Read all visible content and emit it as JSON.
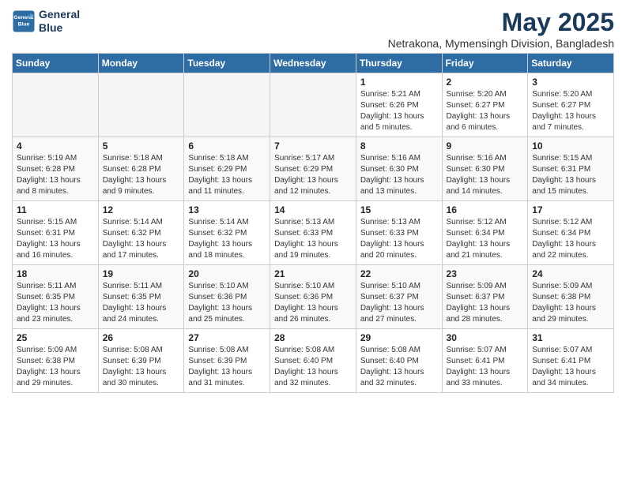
{
  "logo": {
    "line1": "General",
    "line2": "Blue"
  },
  "title": "May 2025",
  "subtitle": "Netrakona, Mymensingh Division, Bangladesh",
  "days_of_week": [
    "Sunday",
    "Monday",
    "Tuesday",
    "Wednesday",
    "Thursday",
    "Friday",
    "Saturday"
  ],
  "weeks": [
    [
      {
        "day": "",
        "info": ""
      },
      {
        "day": "",
        "info": ""
      },
      {
        "day": "",
        "info": ""
      },
      {
        "day": "",
        "info": ""
      },
      {
        "day": "1",
        "info": "Sunrise: 5:21 AM\nSunset: 6:26 PM\nDaylight: 13 hours\nand 5 minutes."
      },
      {
        "day": "2",
        "info": "Sunrise: 5:20 AM\nSunset: 6:27 PM\nDaylight: 13 hours\nand 6 minutes."
      },
      {
        "day": "3",
        "info": "Sunrise: 5:20 AM\nSunset: 6:27 PM\nDaylight: 13 hours\nand 7 minutes."
      }
    ],
    [
      {
        "day": "4",
        "info": "Sunrise: 5:19 AM\nSunset: 6:28 PM\nDaylight: 13 hours\nand 8 minutes."
      },
      {
        "day": "5",
        "info": "Sunrise: 5:18 AM\nSunset: 6:28 PM\nDaylight: 13 hours\nand 9 minutes."
      },
      {
        "day": "6",
        "info": "Sunrise: 5:18 AM\nSunset: 6:29 PM\nDaylight: 13 hours\nand 11 minutes."
      },
      {
        "day": "7",
        "info": "Sunrise: 5:17 AM\nSunset: 6:29 PM\nDaylight: 13 hours\nand 12 minutes."
      },
      {
        "day": "8",
        "info": "Sunrise: 5:16 AM\nSunset: 6:30 PM\nDaylight: 13 hours\nand 13 minutes."
      },
      {
        "day": "9",
        "info": "Sunrise: 5:16 AM\nSunset: 6:30 PM\nDaylight: 13 hours\nand 14 minutes."
      },
      {
        "day": "10",
        "info": "Sunrise: 5:15 AM\nSunset: 6:31 PM\nDaylight: 13 hours\nand 15 minutes."
      }
    ],
    [
      {
        "day": "11",
        "info": "Sunrise: 5:15 AM\nSunset: 6:31 PM\nDaylight: 13 hours\nand 16 minutes."
      },
      {
        "day": "12",
        "info": "Sunrise: 5:14 AM\nSunset: 6:32 PM\nDaylight: 13 hours\nand 17 minutes."
      },
      {
        "day": "13",
        "info": "Sunrise: 5:14 AM\nSunset: 6:32 PM\nDaylight: 13 hours\nand 18 minutes."
      },
      {
        "day": "14",
        "info": "Sunrise: 5:13 AM\nSunset: 6:33 PM\nDaylight: 13 hours\nand 19 minutes."
      },
      {
        "day": "15",
        "info": "Sunrise: 5:13 AM\nSunset: 6:33 PM\nDaylight: 13 hours\nand 20 minutes."
      },
      {
        "day": "16",
        "info": "Sunrise: 5:12 AM\nSunset: 6:34 PM\nDaylight: 13 hours\nand 21 minutes."
      },
      {
        "day": "17",
        "info": "Sunrise: 5:12 AM\nSunset: 6:34 PM\nDaylight: 13 hours\nand 22 minutes."
      }
    ],
    [
      {
        "day": "18",
        "info": "Sunrise: 5:11 AM\nSunset: 6:35 PM\nDaylight: 13 hours\nand 23 minutes."
      },
      {
        "day": "19",
        "info": "Sunrise: 5:11 AM\nSunset: 6:35 PM\nDaylight: 13 hours\nand 24 minutes."
      },
      {
        "day": "20",
        "info": "Sunrise: 5:10 AM\nSunset: 6:36 PM\nDaylight: 13 hours\nand 25 minutes."
      },
      {
        "day": "21",
        "info": "Sunrise: 5:10 AM\nSunset: 6:36 PM\nDaylight: 13 hours\nand 26 minutes."
      },
      {
        "day": "22",
        "info": "Sunrise: 5:10 AM\nSunset: 6:37 PM\nDaylight: 13 hours\nand 27 minutes."
      },
      {
        "day": "23",
        "info": "Sunrise: 5:09 AM\nSunset: 6:37 PM\nDaylight: 13 hours\nand 28 minutes."
      },
      {
        "day": "24",
        "info": "Sunrise: 5:09 AM\nSunset: 6:38 PM\nDaylight: 13 hours\nand 29 minutes."
      }
    ],
    [
      {
        "day": "25",
        "info": "Sunrise: 5:09 AM\nSunset: 6:38 PM\nDaylight: 13 hours\nand 29 minutes."
      },
      {
        "day": "26",
        "info": "Sunrise: 5:08 AM\nSunset: 6:39 PM\nDaylight: 13 hours\nand 30 minutes."
      },
      {
        "day": "27",
        "info": "Sunrise: 5:08 AM\nSunset: 6:39 PM\nDaylight: 13 hours\nand 31 minutes."
      },
      {
        "day": "28",
        "info": "Sunrise: 5:08 AM\nSunset: 6:40 PM\nDaylight: 13 hours\nand 32 minutes."
      },
      {
        "day": "29",
        "info": "Sunrise: 5:08 AM\nSunset: 6:40 PM\nDaylight: 13 hours\nand 32 minutes."
      },
      {
        "day": "30",
        "info": "Sunrise: 5:07 AM\nSunset: 6:41 PM\nDaylight: 13 hours\nand 33 minutes."
      },
      {
        "day": "31",
        "info": "Sunrise: 5:07 AM\nSunset: 6:41 PM\nDaylight: 13 hours\nand 34 minutes."
      }
    ]
  ]
}
